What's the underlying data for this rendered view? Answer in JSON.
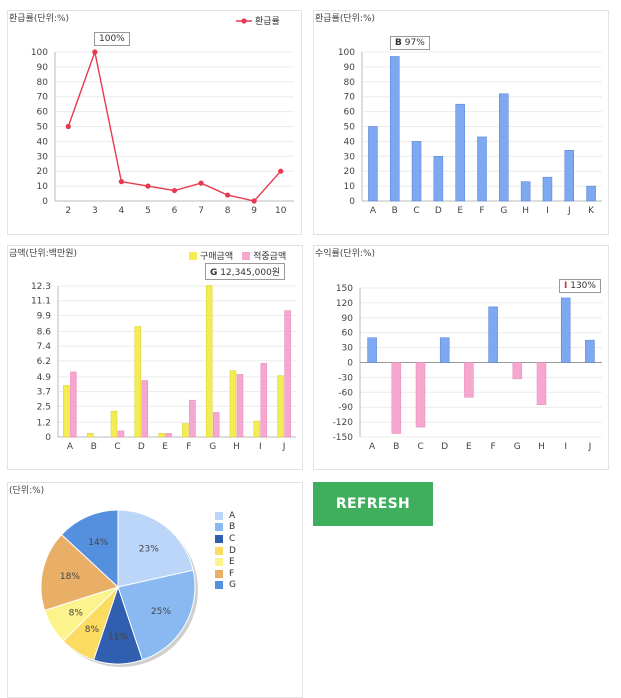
{
  "refresh_label": "REFRESH",
  "chart_data": [
    {
      "id": "c1",
      "type": "line",
      "title": "환급률(단위:%)",
      "legend_position": "top-right",
      "categories": [
        "2",
        "3",
        "4",
        "5",
        "6",
        "7",
        "8",
        "9",
        "10"
      ],
      "series": [
        {
          "name": "환급률",
          "values": [
            50,
            100,
            13,
            10,
            7,
            12,
            4,
            0,
            20
          ]
        }
      ],
      "ylim": [
        0,
        100
      ],
      "yticks": [
        0,
        10,
        20,
        30,
        40,
        50,
        60,
        70,
        80,
        90,
        100
      ],
      "color": "#e8384f",
      "tooltip": {
        "label": "100%"
      }
    },
    {
      "id": "c2",
      "type": "bar",
      "title": "환급률(단위:%)",
      "categories": [
        "A",
        "B",
        "C",
        "D",
        "E",
        "F",
        "G",
        "H",
        "I",
        "J",
        "K"
      ],
      "values": [
        50,
        97,
        40,
        30,
        65,
        43,
        72,
        13,
        16,
        34,
        10
      ],
      "ylim": [
        0,
        100
      ],
      "yticks": [
        0,
        10,
        20,
        30,
        40,
        50,
        60,
        70,
        80,
        90,
        100
      ],
      "color": "#7ea8f0",
      "tooltip": {
        "key": "B",
        "label": "97%"
      }
    },
    {
      "id": "c3",
      "type": "bar",
      "title": "금액(단위:백만원)",
      "legend_position": "top-right",
      "categories": [
        "A",
        "B",
        "C",
        "D",
        "E",
        "F",
        "G",
        "H",
        "I",
        "J"
      ],
      "series": [
        {
          "name": "구매금액",
          "color": "#f4ec53",
          "values": [
            4.2,
            0.3,
            2.1,
            9.0,
            0.3,
            1.1,
            12.345,
            5.4,
            1.3,
            5.0
          ]
        },
        {
          "name": "적중금액",
          "color": "#f7a6cf",
          "values": [
            5.3,
            0,
            0.5,
            4.6,
            0.3,
            3.0,
            2.0,
            5.1,
            6.0,
            10.3
          ]
        }
      ],
      "ylim": [
        0,
        12.3
      ],
      "yticks": [
        "0",
        "1.2",
        "2.5",
        "3.7",
        "4.9",
        "6.2",
        "7.4",
        "8.6",
        "9.9",
        "11.1",
        "12.3"
      ],
      "tooltip": {
        "key": "G",
        "label": "12,345,000원"
      }
    },
    {
      "id": "c4",
      "type": "bar",
      "title": "수익률(단위:%)",
      "categories": [
        "A",
        "B",
        "C",
        "D",
        "E",
        "F",
        "G",
        "H",
        "I",
        "J"
      ],
      "values": [
        50,
        -143,
        -130,
        50,
        -70,
        112,
        -33,
        -85,
        130,
        45
      ],
      "ylim": [
        -150,
        150
      ],
      "yticks": [
        -150,
        -120,
        -90,
        -60,
        -30,
        0,
        30,
        60,
        90,
        120,
        150
      ],
      "positive_color": "#7ea8f0",
      "negative_color": "#f7a6cf",
      "tooltip": {
        "key": "I",
        "label": "130%"
      }
    },
    {
      "id": "c5",
      "type": "pie",
      "title": "(단위:%)",
      "legend_position": "right",
      "slices": [
        {
          "label": "A",
          "value": 23,
          "color": "#bcd6fa"
        },
        {
          "label": "B",
          "value": 25,
          "color": "#8ab9f1"
        },
        {
          "label": "C",
          "value": 11,
          "color": "#2f5fae"
        },
        {
          "label": "D",
          "value": 8,
          "color": "#fbdc60"
        },
        {
          "label": "E",
          "value": 8,
          "color": "#fdf38c"
        },
        {
          "label": "F",
          "value": 18,
          "color": "#eaaf67"
        },
        {
          "label": "G",
          "value": 14,
          "color": "#5590df"
        }
      ]
    }
  ]
}
